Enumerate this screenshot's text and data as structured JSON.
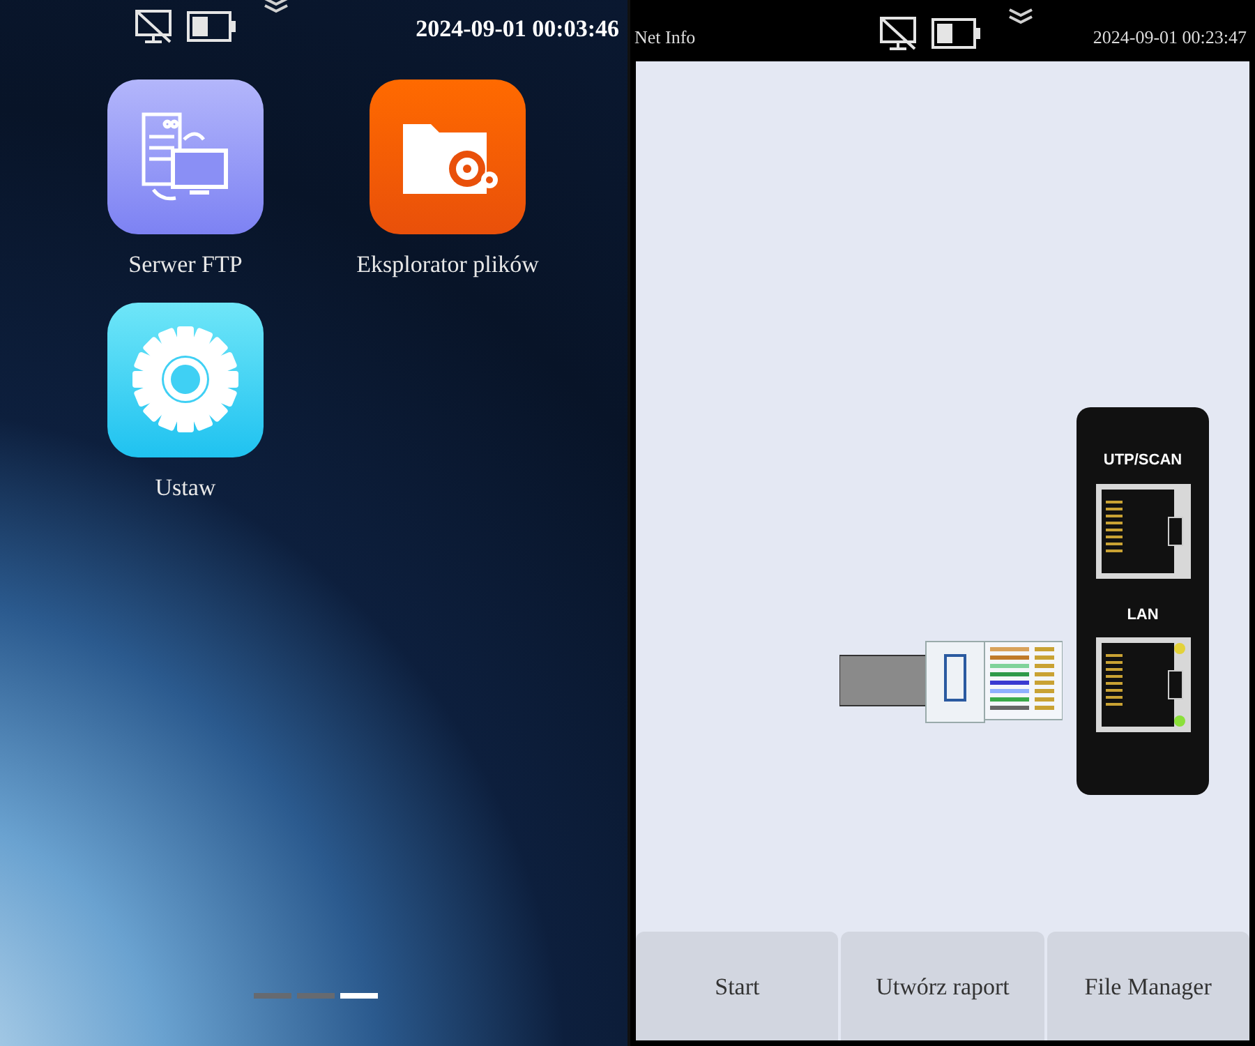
{
  "home_screen": {
    "status_bar": {
      "time": "2024-09-01 00:03:46"
    },
    "apps": [
      {
        "label": "Serwer FTP",
        "kind": "ftp"
      },
      {
        "label": "Eksplorator plików",
        "kind": "files"
      },
      {
        "label": "Ustaw",
        "kind": "settings"
      }
    ],
    "pages": [
      {
        "selected": false
      },
      {
        "selected": false
      },
      {
        "selected": true
      }
    ]
  },
  "net_info": {
    "status_bar": {
      "title": "Net Info",
      "time": "2024-09-01 00:23:47"
    },
    "ports": [
      {
        "label": "UTP/SCAN",
        "link_lights": false
      },
      {
        "label": "LAN",
        "link_lights": true
      }
    ],
    "buttons": [
      "Start",
      "Utwórz raport",
      "File Manager"
    ]
  }
}
